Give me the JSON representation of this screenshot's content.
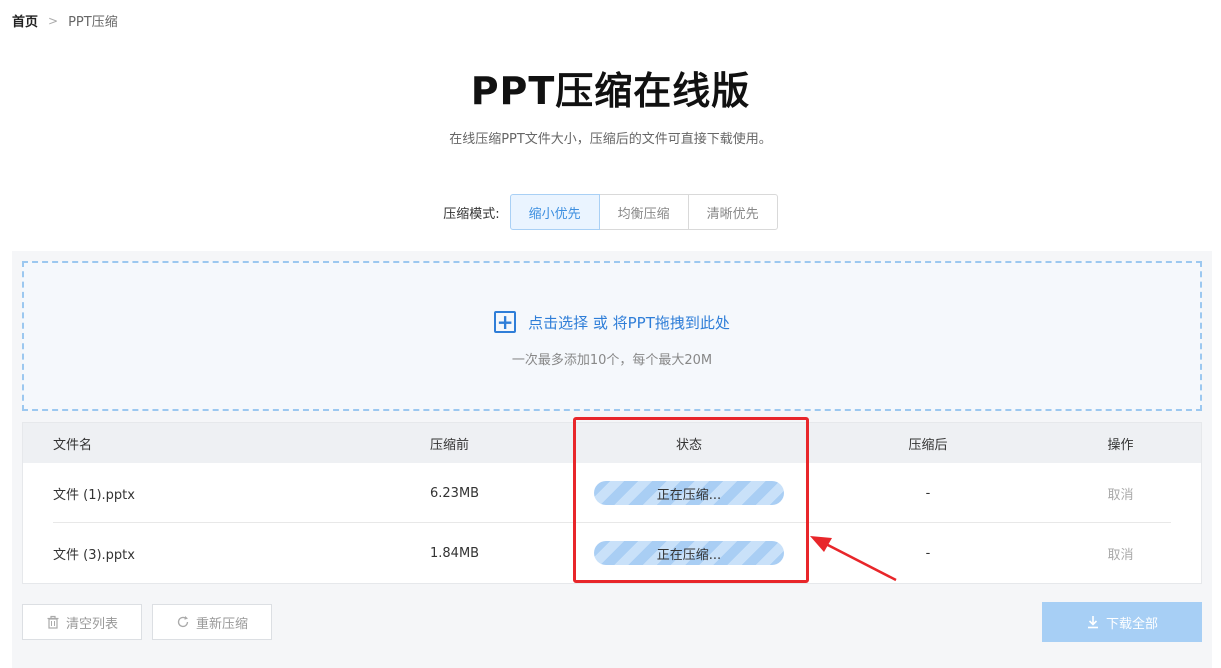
{
  "breadcrumb": {
    "home": "首页",
    "current": "PPT压缩"
  },
  "header": {
    "title": "PPT压缩在线版",
    "subtitle": "在线压缩PPT文件大小，压缩后的文件可直接下载使用。"
  },
  "mode": {
    "label": "压缩模式:",
    "options": [
      "缩小优先",
      "均衡压缩",
      "清晰优先"
    ],
    "selected": "缩小优先"
  },
  "dropzone": {
    "text": "点击选择 或 将PPT拖拽到此处",
    "hint": "一次最多添加10个，每个最大20M"
  },
  "table": {
    "headers": {
      "name": "文件名",
      "before": "压缩前",
      "status": "状态",
      "after": "压缩后",
      "action": "操作"
    },
    "rows": [
      {
        "name": "文件 (1).pptx",
        "before": "6.23MB",
        "status": "正在压缩...",
        "after": "-",
        "action": "取消"
      },
      {
        "name": "文件 (3).pptx",
        "before": "1.84MB",
        "status": "正在压缩...",
        "after": "-",
        "action": "取消"
      }
    ]
  },
  "footer": {
    "clear_label": "清空列表",
    "restart_label": "重新压缩",
    "download_label": "下载全部"
  },
  "colors": {
    "accent": "#2f7ed8",
    "highlight": "#e8262a",
    "progress": "#a9cef4",
    "download_button": "#a7cff5"
  },
  "icons": {
    "separator": "chevron-right-icon",
    "add": "plus-square-icon",
    "clear": "trash-icon",
    "restart": "refresh-icon",
    "download": "download-icon"
  }
}
